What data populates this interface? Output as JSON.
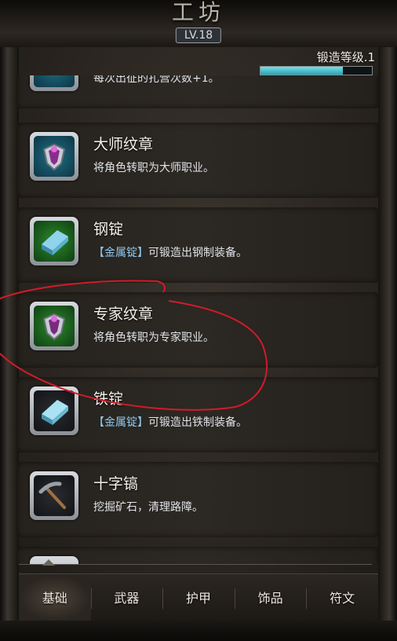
{
  "header": {
    "title": "工坊",
    "level": "LV.18",
    "forge_label": "锻造等级.1",
    "forge_progress": 0.74
  },
  "items": [
    {
      "name": "",
      "desc": "每次出征的扎营次数+1。",
      "icon": "partial-item-icon"
    },
    {
      "name": "大师纹章",
      "desc": "将角色转职为大师职业。",
      "icon": "master-emblem-icon"
    },
    {
      "name": "钢锭",
      "desc_tag": "【金属锭】",
      "desc": "可锻造出钢制装备。",
      "icon": "steel-ingot-icon"
    },
    {
      "name": "专家纹章",
      "desc": "将角色转职为专家职业。",
      "icon": "expert-emblem-icon"
    },
    {
      "name": "铁锭",
      "desc_tag": "【金属锭】",
      "desc": "可锻造出铁制装备。",
      "icon": "iron-ingot-icon"
    },
    {
      "name": "十字镐",
      "desc": "挖掘矿石，清理路障。",
      "icon": "pickaxe-icon"
    }
  ],
  "tabs": [
    {
      "label": "基础",
      "active": true
    },
    {
      "label": "武器"
    },
    {
      "label": "护甲"
    },
    {
      "label": "饰品"
    },
    {
      "label": "符文"
    }
  ],
  "colors": {
    "accent_cyan": "#2aa2b3",
    "annotation_red": "#d21b2a",
    "desc_tag_blue": "#8ec8ee"
  }
}
